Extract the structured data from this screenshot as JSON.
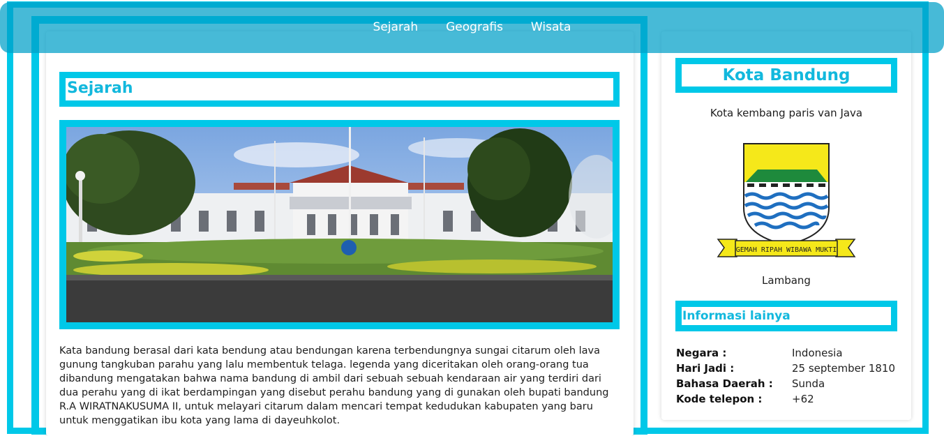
{
  "nav": {
    "items": [
      {
        "label": "Sejarah"
      },
      {
        "label": "Geografis"
      },
      {
        "label": "Wisata"
      }
    ]
  },
  "main": {
    "section_title": "Sejarah",
    "article": "Kata bandung berasal dari kata bendung atau bendungan karena terbendungnya sungai citarum oleh lava gunung tangkuban parahu yang lalu membentuk telaga. legenda yang diceritakan oleh orang-orang tua dibandung mengatakan bahwa nama bandung di ambil dari sebuah sebuah kendaraan air yang terdiri dari dua perahu yang di ikat berdampingan yang disebut perahu bandung yang di gunakan oleh bupati bandung R.A WIRATNAKUSUMA II, untuk melayari citarum dalam mencari tempat kedudukan kabupaten yang baru untuk menggatikan ibu kota yang lama di dayeuhkolot."
  },
  "sidebar": {
    "title": "Kota Bandung",
    "tagline": "Kota kembang paris van Java",
    "emblem_motto": "GEMAH RIPAH WIBAWA MUKTI",
    "emblem_caption": "Lambang",
    "info_title": "Informasi lainya",
    "info": [
      {
        "key": "Negara :",
        "value": "Indonesia"
      },
      {
        "key": "Hari Jadi :",
        "value": "25 september 1810"
      },
      {
        "key": "Bahasa Daerah :",
        "value": "Sunda"
      },
      {
        "key": "Kode telepon :",
        "value": "+62"
      }
    ]
  },
  "colors": {
    "accent": "#00c8e8",
    "heading_text": "#12b8dd",
    "navbar": "#00a0c8"
  }
}
